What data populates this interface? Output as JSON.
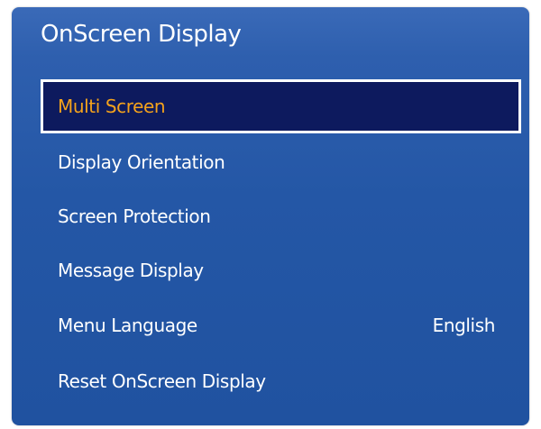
{
  "menu": {
    "title": "OnScreen Display",
    "items": [
      {
        "label": "Multi Screen",
        "value": ""
      },
      {
        "label": "Display Orientation",
        "value": ""
      },
      {
        "label": "Screen Protection",
        "value": ""
      },
      {
        "label": "Message Display",
        "value": ""
      },
      {
        "label": "Menu Language",
        "value": "English"
      },
      {
        "label": "Reset OnScreen Display",
        "value": ""
      }
    ],
    "selected_index": 0
  },
  "colors": {
    "panel_background": "#2457a6",
    "selected_background": "#0d1a5e",
    "selected_text": "#f4a21c",
    "text": "#ffffff",
    "selection_border": "#ffffff"
  }
}
